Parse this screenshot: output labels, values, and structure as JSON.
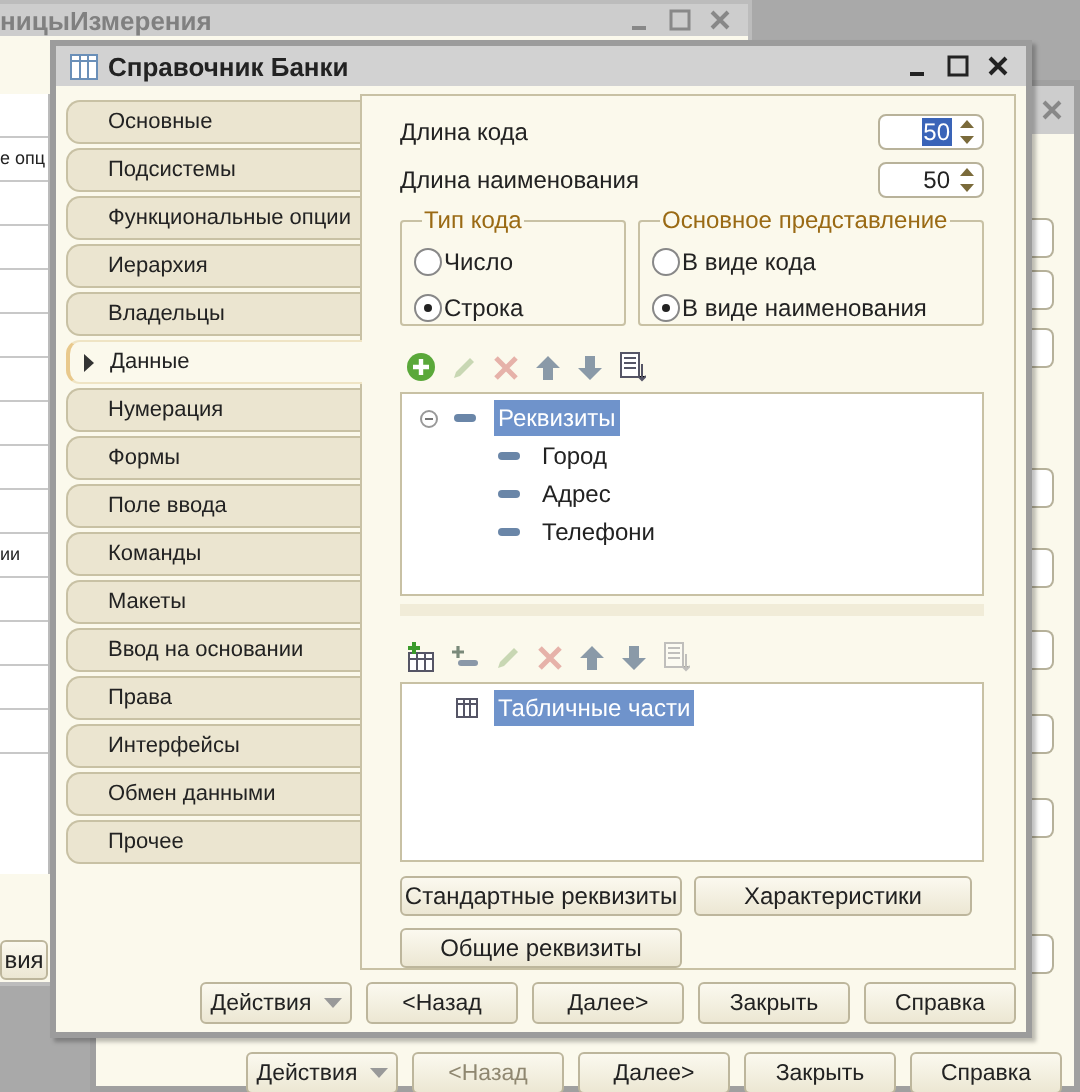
{
  "back_window_left": {
    "title": "ницыИзмерения",
    "list_items": [
      "е опц",
      "ии"
    ],
    "button": "вия"
  },
  "back_window_right": {
    "buttons": [
      {
        "label": "Действия",
        "kind": "dropdown",
        "disabled": false
      },
      {
        "label": "<Назад",
        "kind": "plain",
        "disabled": true
      },
      {
        "label": "Далее>",
        "kind": "plain",
        "disabled": false
      },
      {
        "label": "Закрыть",
        "kind": "plain",
        "disabled": false
      },
      {
        "label": "Справка",
        "kind": "plain",
        "disabled": false
      }
    ]
  },
  "dialog": {
    "title": "Справочник Банки",
    "tabs": [
      {
        "label": "Основные",
        "selected": false
      },
      {
        "label": "Подсистемы",
        "selected": false
      },
      {
        "label": "Функциональные опции",
        "selected": false
      },
      {
        "label": "Иерархия",
        "selected": false
      },
      {
        "label": "Владельцы",
        "selected": false
      },
      {
        "label": "Данные",
        "selected": true
      },
      {
        "label": "Нумерация",
        "selected": false
      },
      {
        "label": "Формы",
        "selected": false
      },
      {
        "label": "Поле ввода",
        "selected": false
      },
      {
        "label": "Команды",
        "selected": false
      },
      {
        "label": "Макеты",
        "selected": false
      },
      {
        "label": "Ввод на основании",
        "selected": false
      },
      {
        "label": "Права",
        "selected": false
      },
      {
        "label": "Интерфейсы",
        "selected": false
      },
      {
        "label": "Обмен данными",
        "selected": false
      },
      {
        "label": "Прочее",
        "selected": false
      }
    ],
    "fields": [
      {
        "label": "Длина кода",
        "value": "50",
        "focused": true
      },
      {
        "label": "Длина наименования",
        "value": "50",
        "focused": false
      }
    ],
    "groups": [
      {
        "title": "Тип кода",
        "options": [
          {
            "label": "Число",
            "selected": false
          },
          {
            "label": "Строка",
            "selected": true
          }
        ]
      },
      {
        "title": "Основное представление",
        "options": [
          {
            "label": "В виде кода",
            "selected": false
          },
          {
            "label": "В виде наименования",
            "selected": true
          }
        ]
      }
    ],
    "attributes_toolbar": [
      {
        "kind": "add",
        "disabled": false
      },
      {
        "kind": "edit",
        "disabled": true
      },
      {
        "kind": "delete",
        "disabled": true
      },
      {
        "kind": "up",
        "disabled": false
      },
      {
        "kind": "down",
        "disabled": false
      },
      {
        "kind": "list",
        "disabled": false
      }
    ],
    "attributes_tree": [
      {
        "label": "Реквизиты",
        "selected": true,
        "expanded": true,
        "children": [
          {
            "label": "Город",
            "selected": false
          },
          {
            "label": "Адрес",
            "selected": false
          },
          {
            "label": "Телефони",
            "selected": false
          }
        ]
      }
    ],
    "tabular_toolbar": [
      {
        "kind": "add-table",
        "disabled": false
      },
      {
        "kind": "add-row",
        "disabled": false
      },
      {
        "kind": "edit",
        "disabled": true
      },
      {
        "kind": "delete",
        "disabled": true
      },
      {
        "kind": "up",
        "disabled": false
      },
      {
        "kind": "down",
        "disabled": false
      },
      {
        "kind": "list",
        "disabled": true
      }
    ],
    "tabular_tree": [
      {
        "label": "Табличные части",
        "selected": true
      }
    ],
    "buttons": [
      {
        "label": "Стандартные реквизиты"
      },
      {
        "label": "Характеристики"
      },
      {
        "label": "Общие реквизиты"
      }
    ],
    "footer_buttons": [
      {
        "label": "Действия",
        "kind": "dropdown",
        "disabled": false
      },
      {
        "label": "<Назад",
        "kind": "plain",
        "disabled": false
      },
      {
        "label": "Далее>",
        "kind": "plain",
        "disabled": false
      },
      {
        "label": "Закрыть",
        "kind": "plain",
        "disabled": false
      },
      {
        "label": "Справка",
        "kind": "plain",
        "disabled": false
      }
    ]
  }
}
